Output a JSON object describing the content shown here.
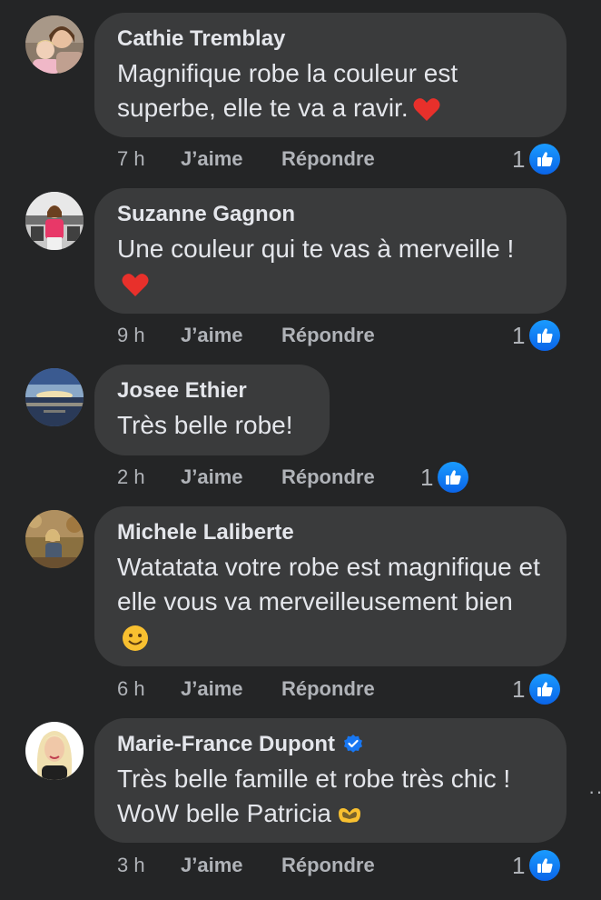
{
  "comments": [
    {
      "author": "Cathie Tremblay",
      "text": "Magnifique robe la couleur est superbe, elle te va a ravir.",
      "emoji": "heart-emoji",
      "time": "7 h",
      "like_label": "J’aime",
      "reply_label": "Répondre",
      "reaction_count": "1"
    },
    {
      "author": "Suzanne Gagnon",
      "text": "Une couleur qui te vas à merveille !",
      "emoji": "heart-emoji",
      "time": "9 h",
      "like_label": "J’aime",
      "reply_label": "Répondre",
      "reaction_count": "1"
    },
    {
      "author": "Josee Ethier",
      "text": "Très belle robe!",
      "emoji": "",
      "time": "2 h",
      "like_label": "J’aime",
      "reply_label": "Répondre",
      "reaction_count": "1"
    },
    {
      "author": "Michele Laliberte",
      "text": "Watatata votre robe est magnifique et elle vous va merveilleusement bien",
      "emoji": "smiling-face-emoji",
      "time": "6 h",
      "like_label": "J’aime",
      "reply_label": "Répondre",
      "reaction_count": "1"
    },
    {
      "author": "Marie-France Dupont",
      "verified": true,
      "text": "Très belle famille et robe très chic ! WoW belle Patricia",
      "emoji": "heart-hands-emoji",
      "time": "3 h",
      "like_label": "J’aime",
      "reply_label": "Répondre",
      "reaction_count": "1"
    }
  ],
  "colors": {
    "background": "#242526",
    "bubble": "#3a3b3c",
    "primary_text": "#e4e6eb",
    "secondary_text": "#b0b3b8",
    "like_blue": "#1877f2",
    "verified_blue": "#1877f2"
  },
  "icons": {
    "reaction": "like-thumb-icon",
    "verified": "verified-badge-icon",
    "more": "more-options-icon"
  },
  "more_label": "··"
}
